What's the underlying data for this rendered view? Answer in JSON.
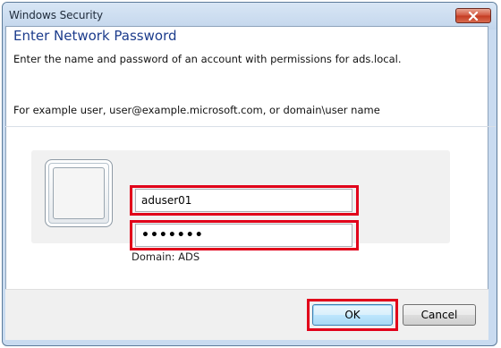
{
  "window": {
    "title": "Windows Security",
    "close_icon": "close-x-icon"
  },
  "dialog": {
    "heading": "Enter Network Password",
    "description": "Enter the name and password of an account with permissions for ads.local.",
    "example": "For example user, user@example.microsoft.com, or domain\\user name"
  },
  "credentials": {
    "avatar_icon": "user-tile-icon",
    "username_value": "aduser01",
    "password_mask": "•••••••",
    "domain_label": "Domain: ADS"
  },
  "buttons": {
    "ok_label": "OK",
    "cancel_label": "Cancel"
  },
  "colors": {
    "highlight": "#e1001a",
    "heading": "#1c3c8c",
    "close_button": "#c43b22"
  }
}
